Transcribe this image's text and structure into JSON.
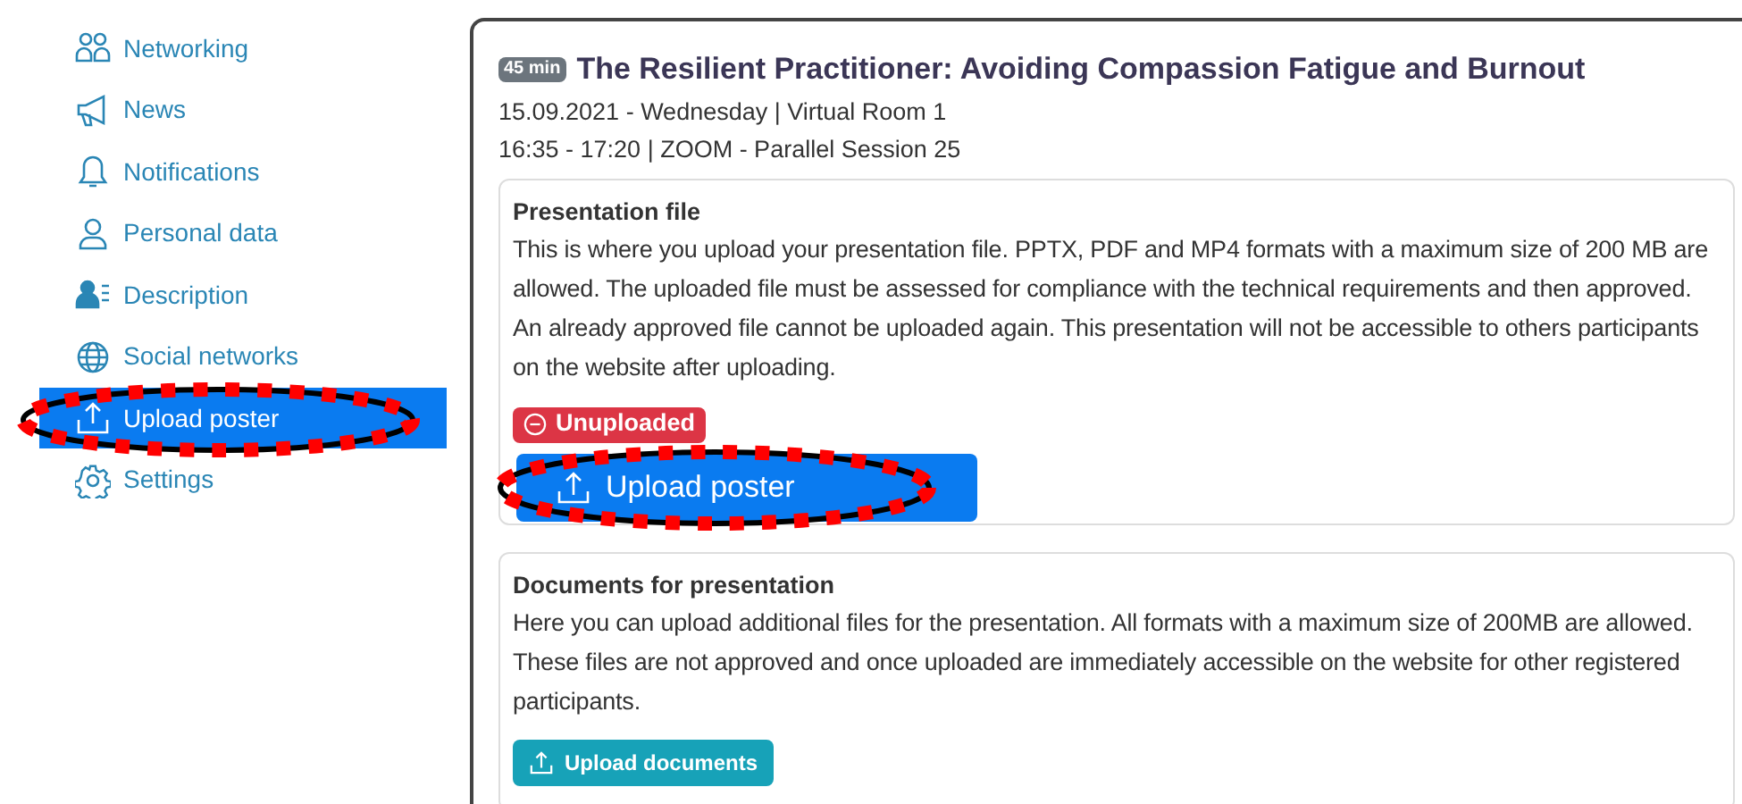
{
  "sidebar": {
    "items": [
      {
        "kind": "people",
        "label": "Networking",
        "selected": false,
        "highlighted": false
      },
      {
        "kind": "megaphone",
        "label": "News",
        "selected": false,
        "highlighted": false
      },
      {
        "kind": "bell",
        "label": "Notifications",
        "selected": false,
        "highlighted": false
      },
      {
        "kind": "person",
        "label": "Personal data",
        "selected": false,
        "highlighted": false
      },
      {
        "kind": "person-list",
        "label": "Description",
        "selected": false,
        "highlighted": false
      },
      {
        "kind": "globe",
        "label": "Social networks",
        "selected": false,
        "highlighted": false
      },
      {
        "kind": "upload",
        "label": "Upload poster",
        "selected": true,
        "highlighted": true
      },
      {
        "kind": "gear",
        "label": "Settings",
        "selected": false,
        "highlighted": false
      }
    ]
  },
  "session": {
    "duration": "45 min",
    "title": "The Resilient Practitioner: Avoiding Compassion Fatigue and Burnout",
    "date_line": "15.09.2021 - Wednesday | Virtual Room 1",
    "time_line": "16:35 - 17:20 | ZOOM - Parallel Session 25"
  },
  "presentation_file": {
    "heading": "Presentation file",
    "text": "This is where you upload your presentation file. PPTX, PDF and MP4 formats with a maximum size of 200 MB are allowed. The uploaded file must be assessed for compliance with the technical requirements and then approved. An already approved file cannot be uploaded again. This presentation will not be accessible to others participants on the website after uploading.",
    "status": "Unuploaded",
    "button": {
      "label": "Upload poster",
      "highlighted": true
    }
  },
  "documents": {
    "heading": "Documents for presentation",
    "text": "Here you can upload additional files for the presentation. All formats with a maximum size of 200MB are allowed. These files are not approved and once uploaded are immediately accessible on the website for other registered participants.",
    "button": "Upload documents"
  }
}
